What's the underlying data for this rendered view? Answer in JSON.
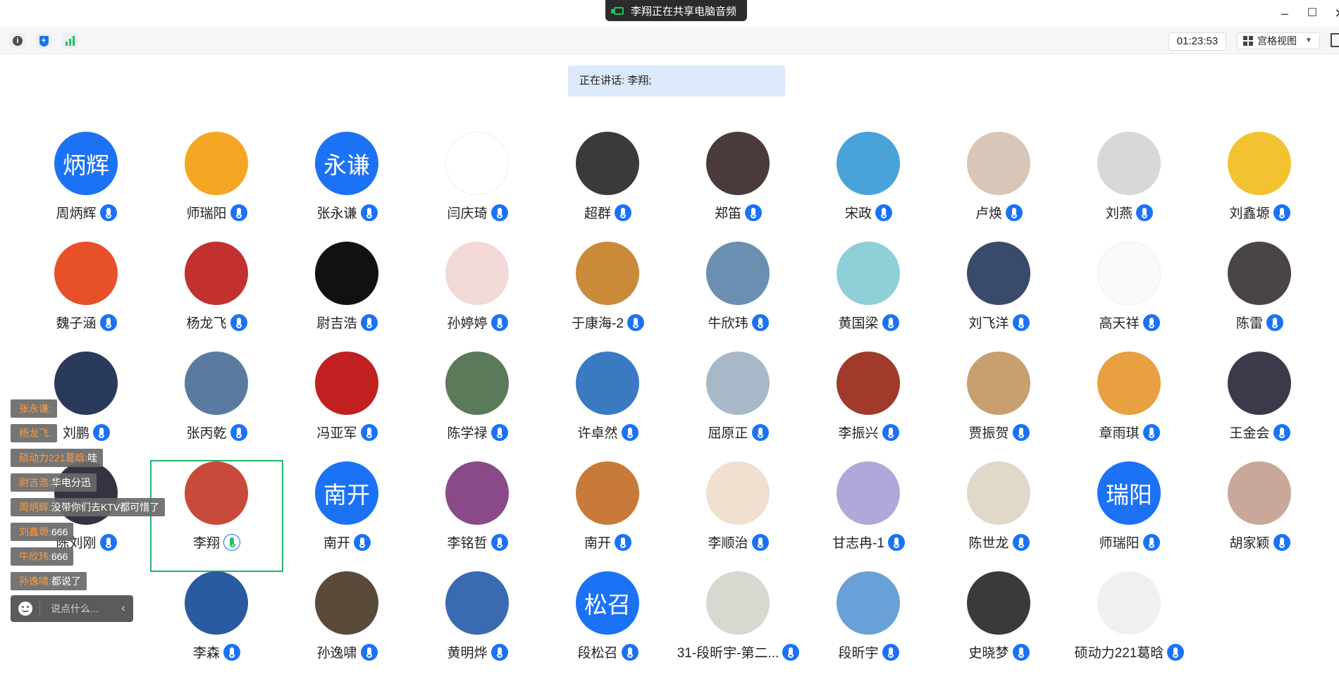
{
  "title_bar": {
    "share_notice": "李翔正在共享电脑音频",
    "minimize_glyph": "–",
    "maximize_glyph": "☐",
    "close_glyph": "✕"
  },
  "toolbar": {
    "timer": "01:23:53",
    "view_mode": "宫格视图",
    "info_glyph": "i",
    "shield_glyph": "+"
  },
  "speaking": {
    "text": "正在讲话: 李翔;"
  },
  "participants": [
    {
      "name": "周炳辉",
      "avatar_text": "炳辉",
      "avatar_color": "#1b72f5"
    },
    {
      "name": "师瑞阳",
      "avatar_color": "#f5a623"
    },
    {
      "name": "张永谦",
      "avatar_text": "永谦",
      "avatar_color": "#1b72f5"
    },
    {
      "name": "闫庆琦",
      "avatar_color": "#ffffff"
    },
    {
      "name": "超群",
      "avatar_color": "#3a3a3a"
    },
    {
      "name": "郑笛",
      "avatar_color": "#4a3a3a"
    },
    {
      "name": "宋政",
      "avatar_color": "#4aa3d8"
    },
    {
      "name": "卢焕",
      "avatar_color": "#d8c7b8"
    },
    {
      "name": "刘燕",
      "avatar_color": "#d8d8d8"
    },
    {
      "name": "刘鑫塬",
      "avatar_color": "#f2c230"
    },
    {
      "name": "魏子涵",
      "avatar_color": "#e8502a"
    },
    {
      "name": "杨龙飞",
      "avatar_color": "#c23030"
    },
    {
      "name": "尉吉浩",
      "avatar_color": "#111111"
    },
    {
      "name": "孙婷婷",
      "avatar_color": "#f3d8d8"
    },
    {
      "name": "于康海-2",
      "avatar_color": "#c98a3a"
    },
    {
      "name": "牛欣玮",
      "avatar_color": "#6a8fb0"
    },
    {
      "name": "黄国梁",
      "avatar_color": "#8fd0d8"
    },
    {
      "name": "刘飞洋",
      "avatar_color": "#3a4a6a"
    },
    {
      "name": "高天祥",
      "avatar_color": "#fafafa"
    },
    {
      "name": "陈雷",
      "avatar_color": "#4a4444"
    },
    {
      "name": "刘鹏",
      "avatar_color": "#2a3a5a"
    },
    {
      "name": "张丙乾",
      "avatar_color": "#5a7aa0"
    },
    {
      "name": "冯亚军",
      "avatar_color": "#c02020"
    },
    {
      "name": "陈学禄",
      "avatar_color": "#5a7a5a"
    },
    {
      "name": "许卓然",
      "avatar_color": "#3a7ac0"
    },
    {
      "name": "屈原正",
      "avatar_color": "#a8b8c8"
    },
    {
      "name": "李振兴",
      "avatar_color": "#a03a2a"
    },
    {
      "name": "贾振贺",
      "avatar_color": "#c8a070"
    },
    {
      "name": "章雨琪",
      "avatar_color": "#e8a040"
    },
    {
      "name": "王金会",
      "avatar_color": "#3a3a4a"
    },
    {
      "name": "陈刘刚",
      "avatar_color": "#333344"
    },
    {
      "name": "李翔",
      "avatar_color": "#c84a3a",
      "speaking": true
    },
    {
      "name": "南开",
      "avatar_text": "南开",
      "avatar_color": "#1b72f5"
    },
    {
      "name": "李铭哲",
      "avatar_color": "#8a4a8a"
    },
    {
      "name": "南开",
      "avatar_color": "#c87a3a"
    },
    {
      "name": "李顺治",
      "avatar_color": "#f0e0d0"
    },
    {
      "name": "甘志冉-1",
      "avatar_color": "#b0a8d8"
    },
    {
      "name": "陈世龙",
      "avatar_color": "#e0d8c8"
    },
    {
      "name": "师瑞阳",
      "avatar_text": "瑞阳",
      "avatar_color": "#1b72f5"
    },
    {
      "name": "胡家颖",
      "avatar_color": "#c8a898"
    },
    {
      "name": "李森",
      "avatar_color": "#2a5aa0"
    },
    {
      "name": "孙逸啸",
      "avatar_color": "#5a4a3a"
    },
    {
      "name": "黄明烨",
      "avatar_color": "#3a6ab0"
    },
    {
      "name": "段松召",
      "avatar_text": "松召",
      "avatar_color": "#1b72f5"
    },
    {
      "name": "31-段昕宇-第二...",
      "avatar_color": "#d8d8d0"
    },
    {
      "name": "段昕宇",
      "avatar_color": "#6aa0d8"
    },
    {
      "name": "史晓梦",
      "avatar_color": "#3a3a3a"
    },
    {
      "name": "硕动力221葛晗",
      "avatar_color": "#f0f0f0"
    }
  ],
  "chat": {
    "messages": [
      {
        "sender": "张永谦:",
        "text": ""
      },
      {
        "sender": "杨龙飞:",
        "text": ""
      },
      {
        "sender": "硕动力221葛晗:",
        "text": "哇"
      },
      {
        "sender": "尉吉浩:",
        "text": "华电分迅"
      },
      {
        "sender": "周炳辉:",
        "text": "没带你们去KTV都可惜了"
      },
      {
        "sender": "刘鑫塬:",
        "text": "666"
      },
      {
        "sender": "牛欣玮:",
        "text": "666"
      },
      {
        "sender": "孙逸啸:",
        "text": "都说了"
      }
    ],
    "input_placeholder": "说点什么...",
    "collapse_glyph": "‹"
  }
}
